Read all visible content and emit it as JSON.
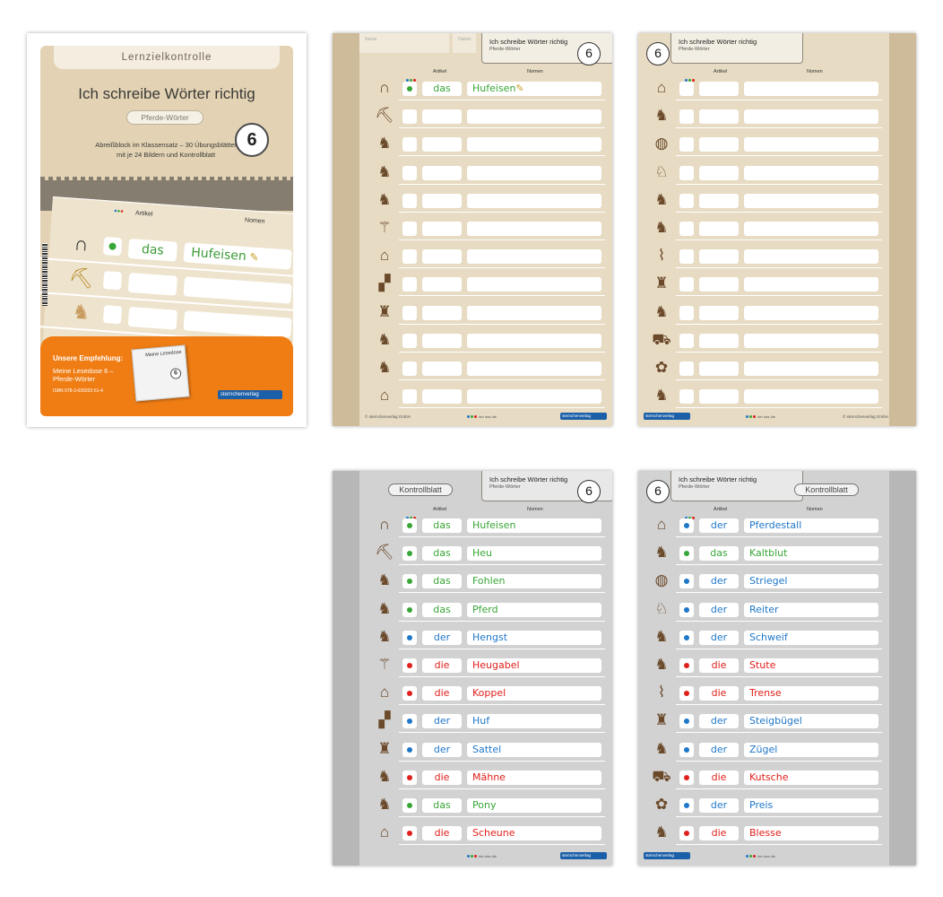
{
  "colors": {
    "der": "#1f77c8",
    "die": "#e0201b",
    "das": "#38a636",
    "beige": "#e7dbc3",
    "grey": "#d2d2d2",
    "orange": "#ef7d14",
    "brand": "#1b5fa8"
  },
  "cover": {
    "tab": "Lernzielkontrolle",
    "title": "Ich schreibe Wörter richtig",
    "subtitle": "Pferde-Wörter",
    "number": "6",
    "desc": "Abreißblock im Klassensatz – 30 Übungsblätter mit je 24 Bildern und Kontrollblatt",
    "col_artikel": "Artikel",
    "col_nomen": "Nomen",
    "example_artikel": "das",
    "example_nomen": "Hufeisen",
    "recommend_title": "Unsere Empfehlung:",
    "recommend_text": "Meine Lesedose 6 – Pferde-Wörter",
    "recommend_isbn": "ISBN 978-3-039203-51-4",
    "book_title": "Meine Lesedose",
    "book_number": "6",
    "logo": "sternchenverlag"
  },
  "sheet": {
    "title": "Ich schreibe Wörter richtig",
    "subtitle": "Pferde-Wörter",
    "number": "6",
    "kontroll": "Kontrollblatt",
    "col_artikel": "Artikel",
    "col_nomen": "Nomen",
    "name_label": "Name",
    "date_label": "Datum",
    "copyright": "© sternchenverlag GmbH",
    "footer_legend": "der  das  die",
    "logo": "sternchenverlag"
  },
  "icons": {
    "left": [
      "horseshoe-icon",
      "hay-pitchfork-icon",
      "foal-icon",
      "horse-icon",
      "stallion-icon",
      "pitchfork-icon",
      "paddock-icon",
      "hoof-icon",
      "saddle-icon",
      "mane-icon",
      "pony-icon",
      "barn-icon"
    ],
    "right": [
      "stable-icon",
      "cold-blood-horse-icon",
      "curry-comb-icon",
      "rider-icon",
      "horse-tail-icon",
      "mare-icon",
      "bridle-icon",
      "stirrup-icon",
      "reins-icon",
      "carriage-icon",
      "rosette-icon",
      "blaze-horse-icon"
    ]
  },
  "words_left": [
    {
      "artikel": "das",
      "nomen": "Hufeisen",
      "color": "#38a636"
    },
    {
      "artikel": "das",
      "nomen": "Heu",
      "color": "#38a636"
    },
    {
      "artikel": "das",
      "nomen": "Fohlen",
      "color": "#38a636"
    },
    {
      "artikel": "das",
      "nomen": "Pferd",
      "color": "#38a636"
    },
    {
      "artikel": "der",
      "nomen": "Hengst",
      "color": "#1f77c8"
    },
    {
      "artikel": "die",
      "nomen": "Heugabel",
      "color": "#e0201b"
    },
    {
      "artikel": "die",
      "nomen": "Koppel",
      "color": "#e0201b"
    },
    {
      "artikel": "der",
      "nomen": "Huf",
      "color": "#1f77c8"
    },
    {
      "artikel": "der",
      "nomen": "Sattel",
      "color": "#1f77c8"
    },
    {
      "artikel": "die",
      "nomen": "Mähne",
      "color": "#e0201b"
    },
    {
      "artikel": "das",
      "nomen": "Pony",
      "color": "#38a636"
    },
    {
      "artikel": "die",
      "nomen": "Scheune",
      "color": "#e0201b"
    }
  ],
  "words_right": [
    {
      "artikel": "der",
      "nomen": "Pferdestall",
      "color": "#1f77c8"
    },
    {
      "artikel": "das",
      "nomen": "Kaltblut",
      "color": "#38a636"
    },
    {
      "artikel": "der",
      "nomen": "Striegel",
      "color": "#1f77c8"
    },
    {
      "artikel": "der",
      "nomen": "Reiter",
      "color": "#1f77c8"
    },
    {
      "artikel": "der",
      "nomen": "Schweif",
      "color": "#1f77c8"
    },
    {
      "artikel": "die",
      "nomen": "Stute",
      "color": "#e0201b"
    },
    {
      "artikel": "die",
      "nomen": "Trense",
      "color": "#e0201b"
    },
    {
      "artikel": "der",
      "nomen": "Steigbügel",
      "color": "#1f77c8"
    },
    {
      "artikel": "der",
      "nomen": "Zügel",
      "color": "#1f77c8"
    },
    {
      "artikel": "die",
      "nomen": "Kutsche",
      "color": "#e0201b"
    },
    {
      "artikel": "der",
      "nomen": "Preis",
      "color": "#1f77c8"
    },
    {
      "artikel": "die",
      "nomen": "Blesse",
      "color": "#e0201b"
    }
  ]
}
